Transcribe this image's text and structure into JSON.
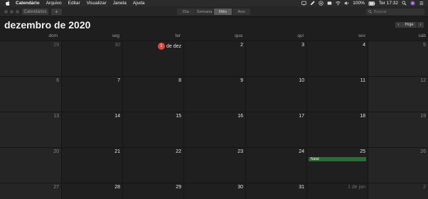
{
  "menubar": {
    "app": "Calendário",
    "items": [
      "Arquivo",
      "Editar",
      "Visualizar",
      "Janela",
      "Ajuda"
    ],
    "battery": "100%",
    "clock": "Ter 17:32"
  },
  "toolbar": {
    "calendars_label": "Calendários",
    "add_label": "+",
    "views": [
      "Dia",
      "Semana",
      "Mês",
      "Ano"
    ],
    "active_view": "Mês",
    "search_placeholder": "Buscar"
  },
  "header": {
    "title": "dezembro de 2020",
    "prev": "‹",
    "today": "Hoje",
    "next": "›"
  },
  "weekdays": [
    "dom",
    "seg",
    "ter",
    "qua",
    "qui",
    "sex",
    "sáb"
  ],
  "weeks": [
    [
      {
        "label": "29",
        "other": true
      },
      {
        "label": "30",
        "other": true
      },
      {
        "label": "de dez",
        "badge": "1",
        "today": true
      },
      {
        "label": "2"
      },
      {
        "label": "3"
      },
      {
        "label": "4"
      },
      {
        "label": "5"
      }
    ],
    [
      {
        "label": "6"
      },
      {
        "label": "7"
      },
      {
        "label": "8"
      },
      {
        "label": "9"
      },
      {
        "label": "10"
      },
      {
        "label": "11"
      },
      {
        "label": "12"
      }
    ],
    [
      {
        "label": "13"
      },
      {
        "label": "14"
      },
      {
        "label": "15"
      },
      {
        "label": "16"
      },
      {
        "label": "17"
      },
      {
        "label": "18"
      },
      {
        "label": "19"
      }
    ],
    [
      {
        "label": "20"
      },
      {
        "label": "21"
      },
      {
        "label": "22"
      },
      {
        "label": "23"
      },
      {
        "label": "24"
      },
      {
        "label": "25",
        "event": "Natal"
      },
      {
        "label": "26"
      }
    ],
    [
      {
        "label": "27"
      },
      {
        "label": "28"
      },
      {
        "label": "29"
      },
      {
        "label": "30"
      },
      {
        "label": "31"
      },
      {
        "label": "1 de jan",
        "other": true
      },
      {
        "label": "2",
        "other": true
      }
    ]
  ],
  "colors": {
    "today_badge": "#e0453e",
    "event_holiday": "#2f6a35"
  }
}
